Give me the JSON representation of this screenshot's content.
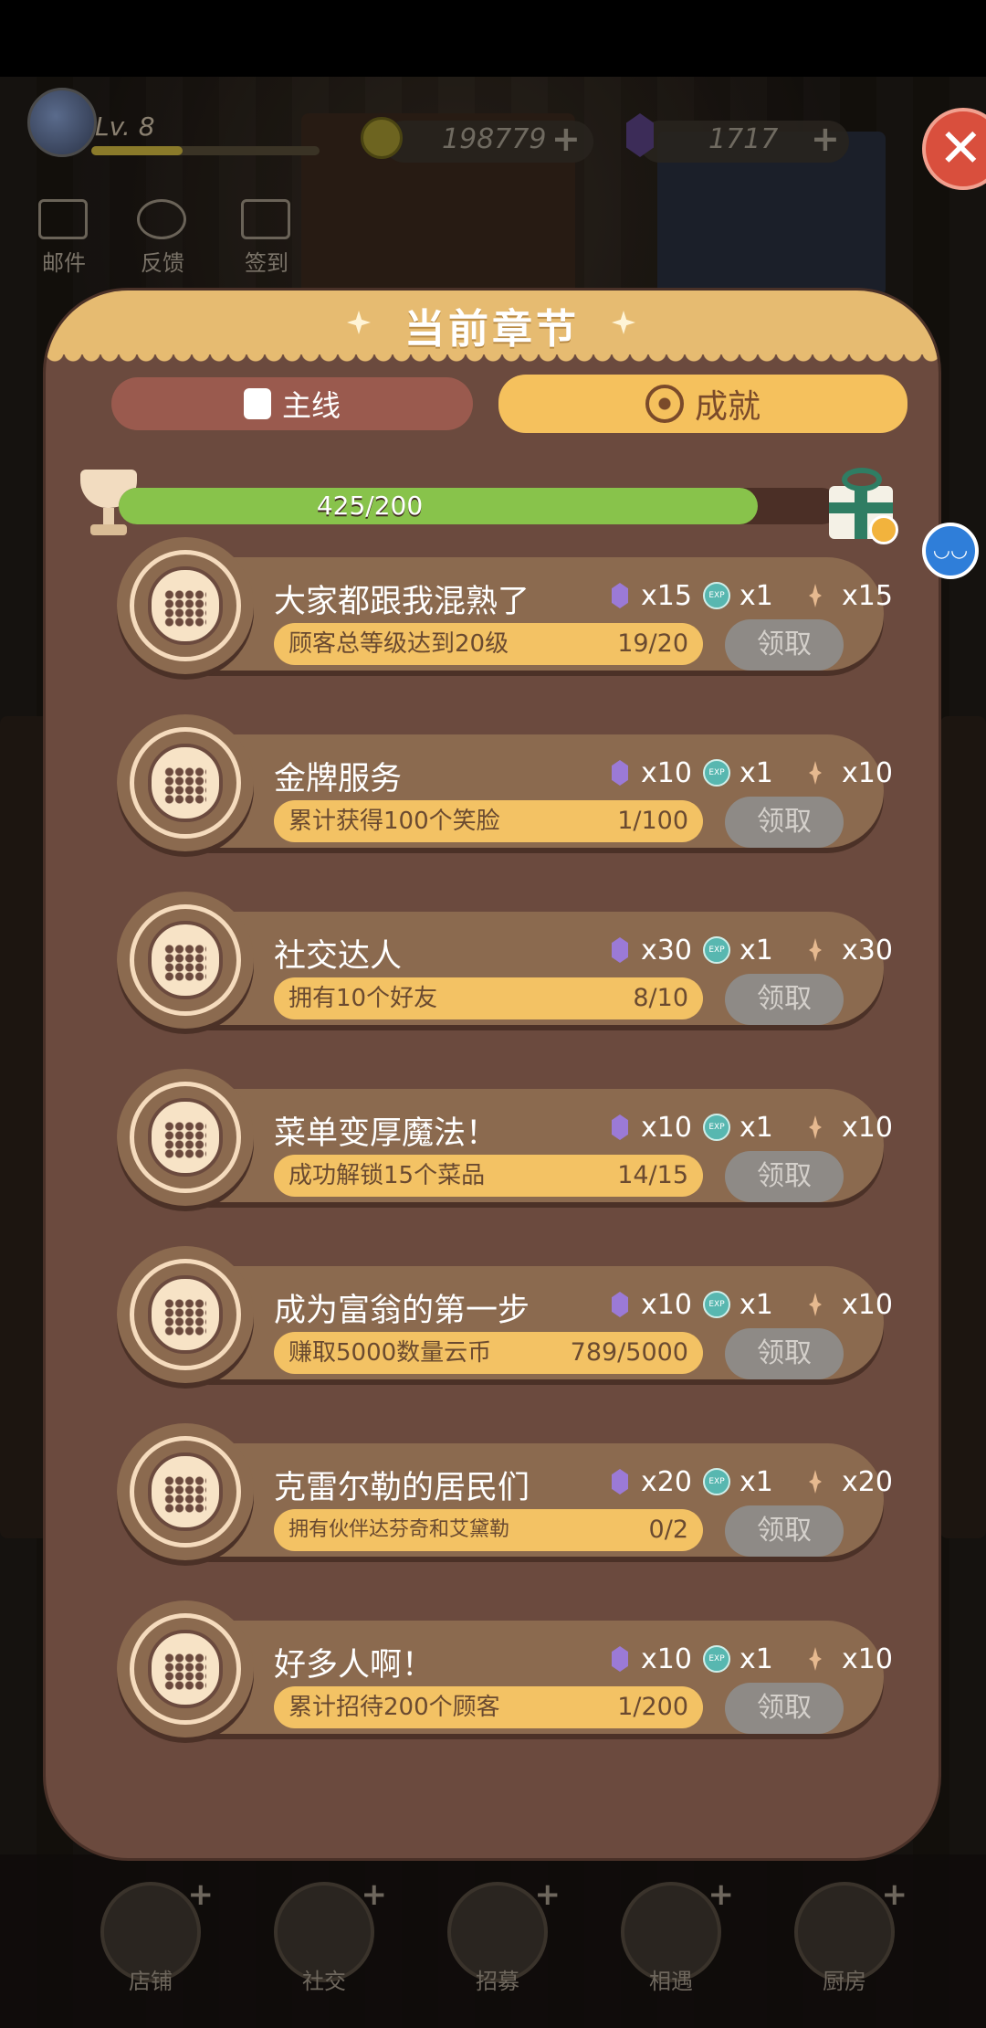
{
  "hud": {
    "level": "Lv. 8",
    "coins": "198779",
    "gems": "1717",
    "plus": "+",
    "shortcuts": [
      {
        "label": "邮件"
      },
      {
        "label": "反馈"
      },
      {
        "label": "签到"
      }
    ]
  },
  "bottom_nav": [
    {
      "label": "店铺"
    },
    {
      "label": "社交"
    },
    {
      "label": "招募"
    },
    {
      "label": "相遇"
    },
    {
      "label": "厨房"
    }
  ],
  "close_label": "✕",
  "panel": {
    "title": "当前章节",
    "tabs": {
      "main": "主线",
      "achievement": "成就"
    },
    "progress": {
      "text": "425/200",
      "fraction": 1.0
    }
  },
  "achievements": [
    {
      "title": "大家都跟我混熟了",
      "gem": "x15",
      "exp": "x1",
      "spark": "x15",
      "task": "顾客总等级达到20级",
      "count": "19/20",
      "claim": "领取"
    },
    {
      "title": "金牌服务",
      "gem": "x10",
      "exp": "x1",
      "spark": "x10",
      "task": "累计获得100个笑脸",
      "count": "1/100",
      "claim": "领取"
    },
    {
      "title": "社交达人",
      "gem": "x30",
      "exp": "x1",
      "spark": "x30",
      "task": "拥有10个好友",
      "count": "8/10",
      "claim": "领取"
    },
    {
      "title": "菜单变厚魔法！",
      "gem": "x10",
      "exp": "x1",
      "spark": "x10",
      "task": "成功解锁15个菜品",
      "count": "14/15",
      "claim": "领取"
    },
    {
      "title": "成为富翁的第一步",
      "gem": "x10",
      "exp": "x1",
      "spark": "x10",
      "task": "赚取5000数量云币",
      "count": "789/5000",
      "claim": "领取"
    },
    {
      "title": "克雷尔勒的居民们",
      "gem": "x20",
      "exp": "x1",
      "spark": "x20",
      "task": "拥有伙伴达芬奇和艾黛勒",
      "count": "0/2",
      "claim": "领取"
    },
    {
      "title": "好多人啊！",
      "gem": "x10",
      "exp": "x1",
      "spark": "x10",
      "task": "累计招待200个顾客",
      "count": "1/200",
      "claim": "领取"
    }
  ],
  "colors": {
    "panel": "#6b4a3e",
    "header": "#e6bb71",
    "task_bar": "#f3c264",
    "progress_fill": "#88c34b",
    "claim_disabled": "#8e8a86",
    "close": "#d94f3d"
  }
}
